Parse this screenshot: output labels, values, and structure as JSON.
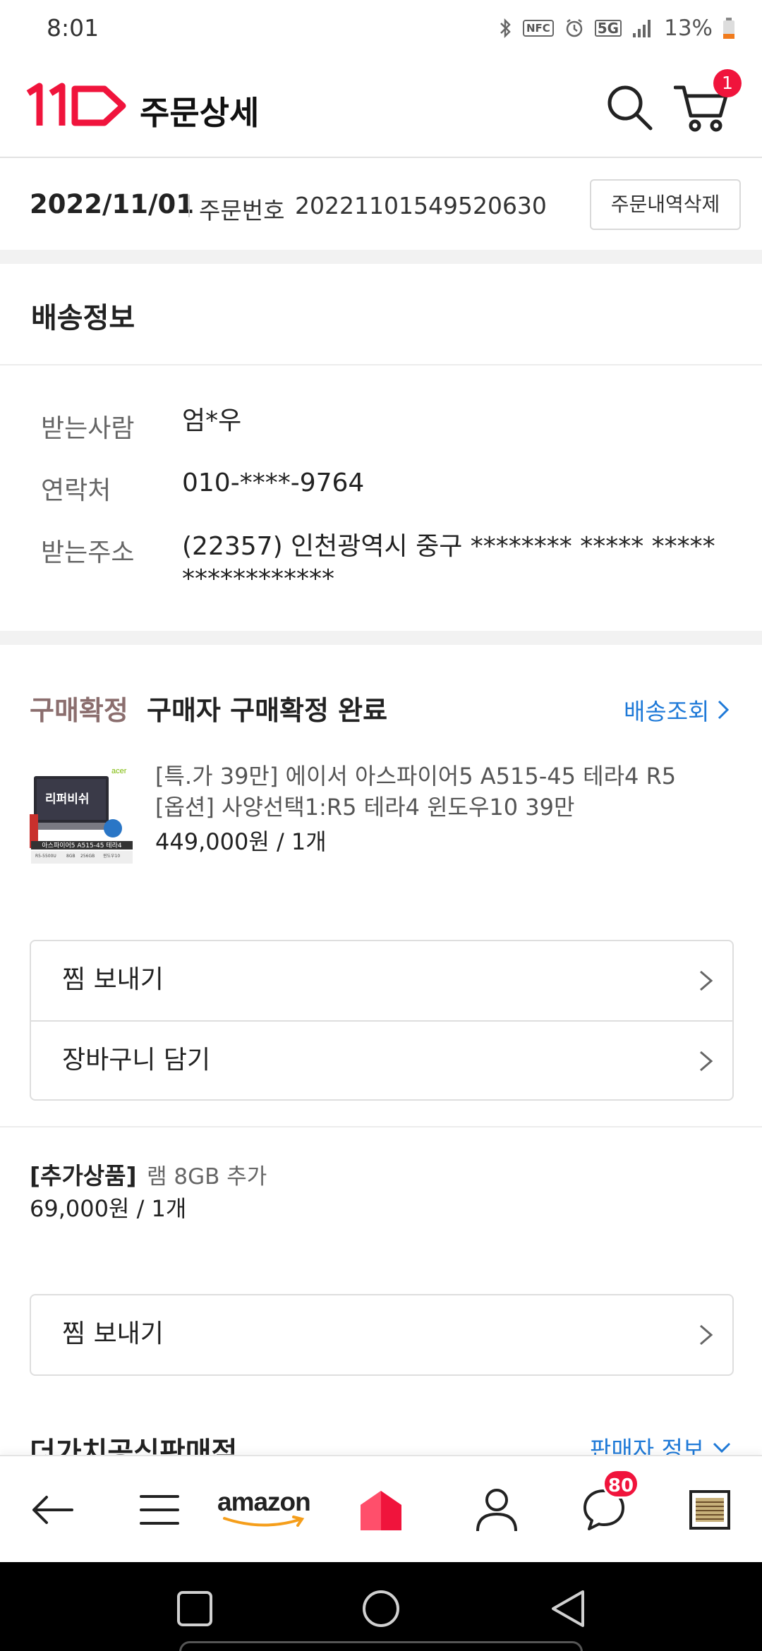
{
  "status_bar": {
    "time": "8:01",
    "battery": "13%",
    "icons": [
      "bluetooth-icon",
      "nfc-icon",
      "alarm-icon",
      "5g-icon",
      "signal-icon",
      "battery-icon"
    ],
    "nfc": "NFC",
    "network": "5G"
  },
  "header": {
    "title": "주문상세",
    "cart_count": "1",
    "logo_color": "#f0143c"
  },
  "order": {
    "date": "2022/11/01",
    "number_label": "주문번호",
    "number": "20221101549520630",
    "delete_label": "주문내역삭제"
  },
  "shipping": {
    "title": "배송정보",
    "rows": [
      {
        "label": "받는사람",
        "value": "엄*우"
      },
      {
        "label": "연락처",
        "value": "010-****-9764"
      },
      {
        "label": "받는주소",
        "value": "(22357) 인천광역시 중구 ******** ***** *****",
        "value2": "************"
      }
    ]
  },
  "purchase": {
    "status_label": "구매확정",
    "status_text": "구매자 구매확정 완료",
    "track_label": "배송조회",
    "product": {
      "thumb_badge": "리퍼비쉬",
      "thumb_brand": "acer",
      "thumb_caption": "아스파이어5 A515-45 테라4",
      "thumb_specs": [
        "R5-5500U",
        "8GB",
        "256GB",
        "윈도우10"
      ],
      "name_line1": "[특.가 39만] 에이서 아스파이어5 A515-45 테라4 R5",
      "name_line2": "[옵션] 사양선택1:R5 테라4 윈도우10 39만",
      "price": "449,000원 / 1개"
    },
    "actions": [
      "찜 보내기",
      "장바구니 담기"
    ]
  },
  "addon": {
    "tag": "[추가상품]",
    "name": "램 8GB 추가",
    "price": "69,000원 / 1개",
    "actions": [
      "찜 보내기"
    ]
  },
  "seller": {
    "name": "더가치공식판매점",
    "info_label": "판매자 정보"
  },
  "bottom_nav": {
    "amazon_label": "amazon",
    "chat_count": "80",
    "home_color": "#f0143c"
  },
  "colors": {
    "accent": "#f0143c",
    "link": "#1f7ad8",
    "confirm": "#8b6e6e"
  }
}
